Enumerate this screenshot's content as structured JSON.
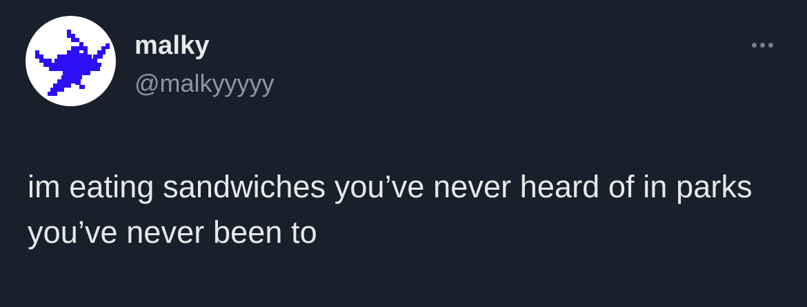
{
  "tweet": {
    "author": {
      "display_name": "malky",
      "handle": "@malkyyyyy",
      "avatar_icon": "pixel-dragon-icon"
    },
    "more_icon": "more-options-icon",
    "text": "im eating sandwiches you’ve never heard of in parks you’ve never been to"
  },
  "colors": {
    "background": "#18212b",
    "primary_text": "#e7e9ea",
    "secondary_text": "#8b98a5",
    "avatar_background": "#ffffff",
    "avatar_icon": "#2b10f5"
  }
}
